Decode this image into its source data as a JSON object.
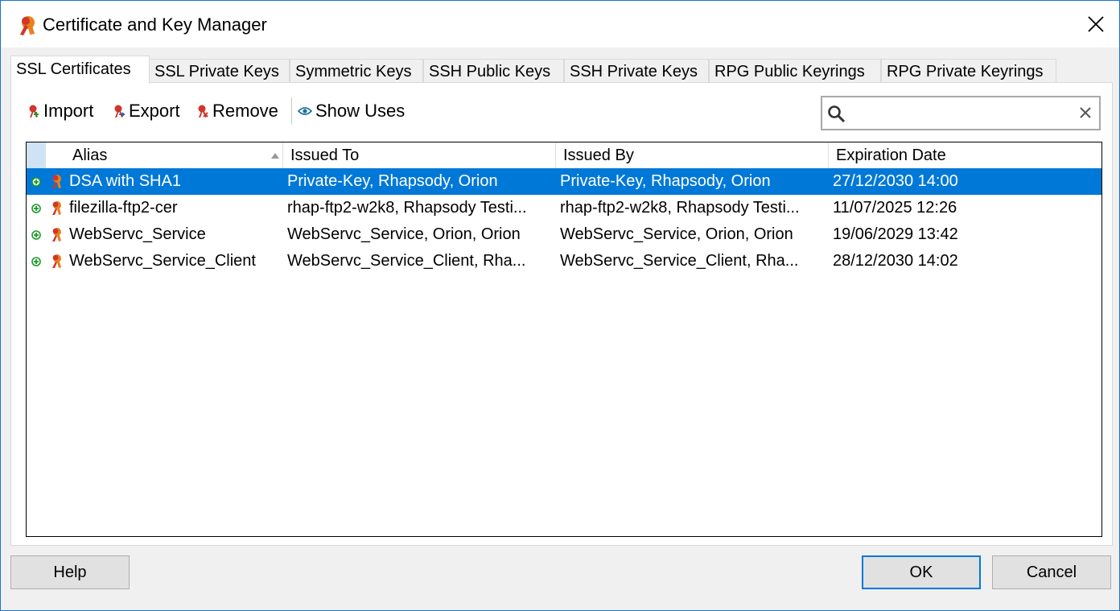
{
  "window": {
    "title": "Certificate and Key Manager"
  },
  "tabs": [
    {
      "label": "SSL Certificates",
      "active": true
    },
    {
      "label": "SSL Private Keys"
    },
    {
      "label": "Symmetric Keys"
    },
    {
      "label": "SSH Public Keys"
    },
    {
      "label": "SSH Private Keys"
    },
    {
      "label": "RPG Public Keyrings"
    },
    {
      "label": "RPG Private Keyrings"
    }
  ],
  "toolbar": {
    "import_label": "Import",
    "export_label": "Export",
    "remove_label": "Remove",
    "show_uses_label": "Show Uses"
  },
  "search": {
    "value": ""
  },
  "table": {
    "columns": [
      "Alias",
      "Issued To",
      "Issued By",
      "Expiration Date"
    ],
    "rows": [
      {
        "alias": "DSA with SHA1",
        "issued_to": "Private-Key, Rhapsody, Orion",
        "issued_by": "Private-Key, Rhapsody, Orion",
        "expiration": "27/12/2030 14:00",
        "selected": true
      },
      {
        "alias": "filezilla-ftp2-cer",
        "issued_to": "rhap-ftp2-w2k8, Rhapsody Testi...",
        "issued_by": "rhap-ftp2-w2k8, Rhapsody Testi...",
        "expiration": "11/07/2025 12:26"
      },
      {
        "alias": "WebServc_Service",
        "issued_to": "WebServc_Service, Orion, Orion",
        "issued_by": "WebServc_Service, Orion, Orion",
        "expiration": "19/06/2029 13:42"
      },
      {
        "alias": "WebServc_Service_Client",
        "issued_to": "WebServc_Service_Client, Rha...",
        "issued_by": "WebServc_Service_Client, Rha...",
        "expiration": "28/12/2030 14:02"
      }
    ]
  },
  "footer": {
    "help_label": "Help",
    "ok_label": "OK",
    "cancel_label": "Cancel"
  },
  "colors": {
    "accent": "#0078d7",
    "icon_red": "#d0362a",
    "icon_orange": "#e8801e",
    "expand_green": "#1a9a2a"
  }
}
